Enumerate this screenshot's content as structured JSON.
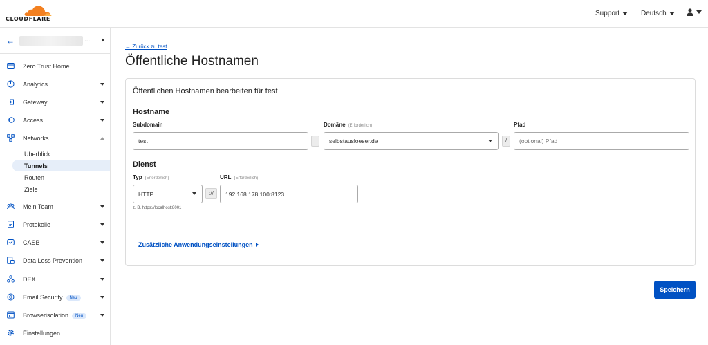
{
  "topbar": {
    "logo_text": "CLOUDFLARE",
    "support_label": "Support",
    "language_label": "Deutsch"
  },
  "sidebar": {
    "items": [
      {
        "label": "Zero Trust Home",
        "icon": "home-icon"
      },
      {
        "label": "Analytics",
        "icon": "analytics-icon"
      },
      {
        "label": "Gateway",
        "icon": "gateway-icon"
      },
      {
        "label": "Access",
        "icon": "access-icon"
      },
      {
        "label": "Networks",
        "icon": "networks-icon"
      },
      {
        "label": "Mein Team",
        "icon": "team-icon"
      },
      {
        "label": "Protokolle",
        "icon": "logs-icon"
      },
      {
        "label": "CASB",
        "icon": "casb-icon"
      },
      {
        "label": "Data Loss Prevention",
        "icon": "dlp-icon"
      },
      {
        "label": "DEX",
        "icon": "dex-icon"
      },
      {
        "label": "Email Security",
        "icon": "email-security-icon",
        "badge": "Neu"
      },
      {
        "label": "Browserisolation",
        "icon": "browser-isolation-icon",
        "badge": "Neu"
      },
      {
        "label": "Einstellungen",
        "icon": "settings-icon"
      }
    ],
    "networks_sub": [
      "Überblick",
      "Tunnels",
      "Routen",
      "Ziele"
    ]
  },
  "main": {
    "back_link": "← Zurück zu test",
    "title": "Öffentliche Hostnamen",
    "card_title": "Öffentlichen Hostnamen bearbeiten für test",
    "hostname_section": "Hostname",
    "subdomain_label": "Subdomain",
    "subdomain_value": "test",
    "domain_label": "Domäne",
    "required_label": "(Erforderlich)",
    "domain_value": "selbstausloeser.de",
    "path_label": "Pfad",
    "path_placeholder": "(optional) Pfad",
    "dot_sep": ".",
    "slash_sep": "/",
    "service_section": "Dienst",
    "type_label": "Typ",
    "type_value": "HTTP",
    "proto_sep": "://",
    "url_label": "URL",
    "url_value": "192.168.178.100:8123",
    "hint": "z. B. https://localhost:8001",
    "more_settings": "Zusätzliche Anwendungseinstellungen",
    "save_label": "Speichern"
  },
  "colors": {
    "accent": "#0051c3",
    "brand_orange": "#f38020"
  }
}
